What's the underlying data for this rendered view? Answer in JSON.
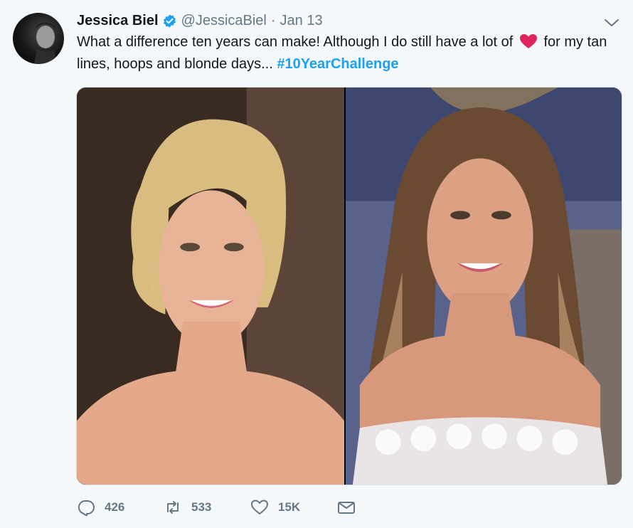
{
  "author": {
    "name": "Jessica Biel",
    "handle": "@JessicaBiel",
    "separator": "·",
    "date": "Jan 13"
  },
  "tweet": {
    "text_part1": "What a difference ten years can make! Although I do still have a lot of",
    "text_part2": "for my tan lines, hoops and blonde days...",
    "hashtag": "#10YearChallenge"
  },
  "media": {
    "left_photo": "portrait-blonde-updo",
    "right_photo": "portrait-long-brown-hair"
  },
  "actions": {
    "reply_count": "426",
    "retweet_count": "533",
    "like_count": "15K"
  },
  "icons": {
    "verified": "verified-badge-icon",
    "heart_emoji": "red-heart-icon",
    "caret": "chevron-down-icon",
    "reply": "reply-icon",
    "retweet": "retweet-icon",
    "like": "like-icon",
    "dm": "direct-message-icon"
  },
  "colors": {
    "link": "#1da1f2",
    "muted": "#657786",
    "text": "#14171a",
    "background": "#f5f8fa",
    "heart": "#e0245e"
  }
}
